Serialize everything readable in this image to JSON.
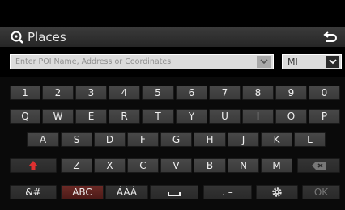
{
  "header": {
    "title": "Places",
    "search_icon": "search-icon",
    "back_icon": "back-arrow-icon"
  },
  "search": {
    "placeholder": "Enter POI Name, Address or Coordinates"
  },
  "unit": {
    "value": "MI"
  },
  "keyboard": {
    "row1": [
      "1",
      "2",
      "3",
      "4",
      "5",
      "6",
      "7",
      "8",
      "9",
      "0"
    ],
    "row2": [
      "Q",
      "W",
      "E",
      "R",
      "T",
      "Y",
      "U",
      "I",
      "O",
      "P"
    ],
    "row3": [
      "A",
      "S",
      "D",
      "F",
      "G",
      "H",
      "J",
      "K",
      "L"
    ],
    "row4": [
      "Z",
      "X",
      "C",
      "V",
      "B",
      "N",
      "M"
    ],
    "symbols_label": "&#",
    "abc_label": "ABC",
    "accents_label": "ÁÀÂ",
    "punct_label": ". –",
    "ok_label": "OK"
  },
  "colors": {
    "selected_key": "#5a2220",
    "shift_arrow": "#e03030"
  }
}
